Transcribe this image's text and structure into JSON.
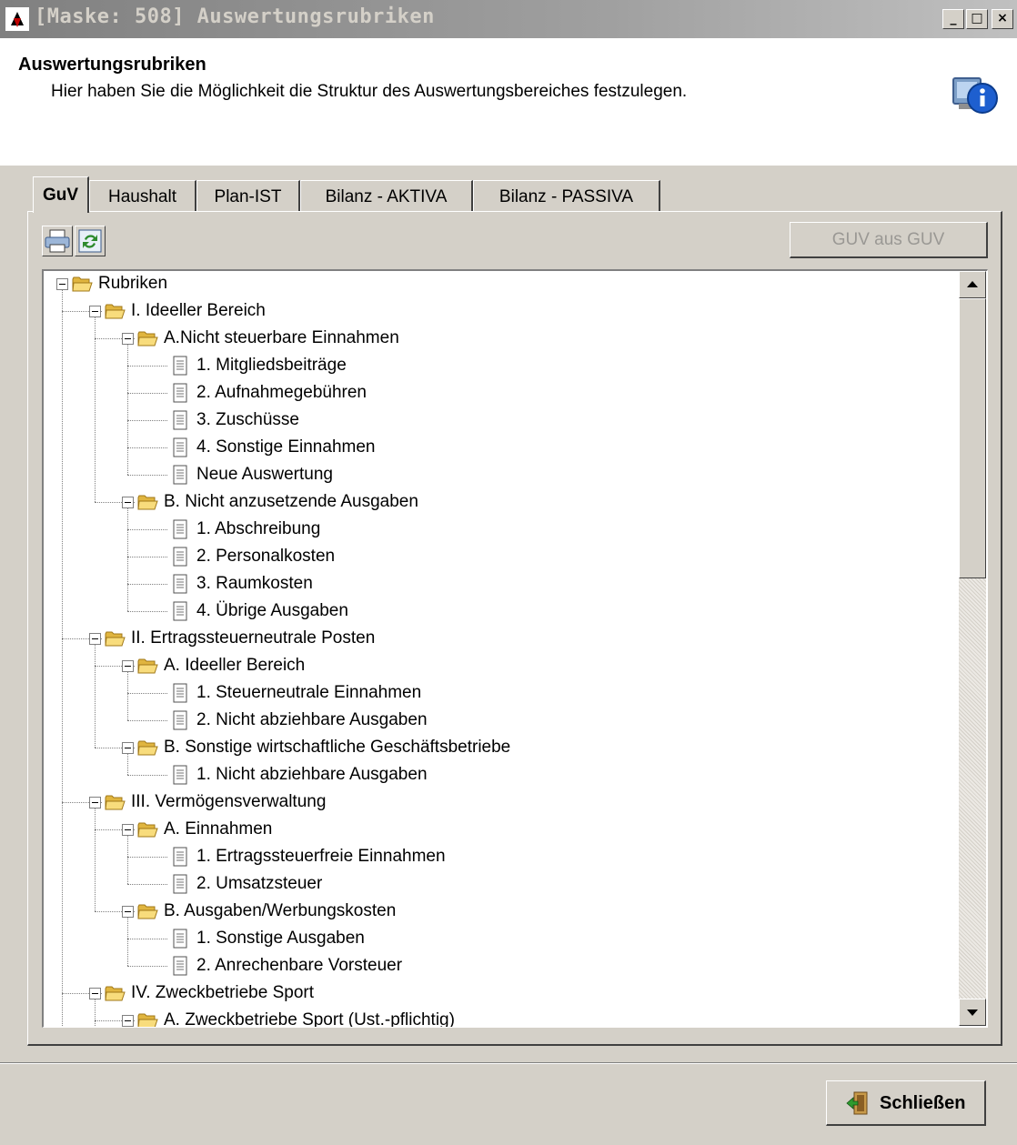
{
  "window": {
    "title": "[Maske: 508] Auswertungsrubriken",
    "controls": [
      "_",
      "□",
      "×"
    ]
  },
  "header": {
    "title": "Auswertungsrubriken",
    "subtitle": "Hier haben Sie die Möglichkeit die Struktur des Auswertungsbereiches festzulegen."
  },
  "tabs": [
    {
      "label": "GuV",
      "active": true
    },
    {
      "label": "Haushalt",
      "active": false
    },
    {
      "label": "Plan-IST",
      "active": false
    },
    {
      "label": "Bilanz - AKTIVA",
      "active": false
    },
    {
      "label": "Bilanz - PASSIVA",
      "active": false
    }
  ],
  "toolbar": {
    "icons": [
      "printer-icon",
      "refresh-icon"
    ],
    "guv_button_label": "GUV aus GUV",
    "guv_button_enabled": false
  },
  "tree": {
    "rows": [
      {
        "label": "Rubriken",
        "level": 0,
        "type": "folder"
      },
      {
        "label": "I. Ideeller Bereich",
        "level": 1,
        "type": "folder"
      },
      {
        "label": "A.Nicht steuerbare Einnahmen",
        "level": 2,
        "type": "folder"
      },
      {
        "label": "1. Mitgliedsbeiträge",
        "level": 3,
        "type": "item"
      },
      {
        "label": "2. Aufnahmegebühren",
        "level": 3,
        "type": "item"
      },
      {
        "label": "3. Zuschüsse",
        "level": 3,
        "type": "item"
      },
      {
        "label": "4. Sonstige Einnahmen",
        "level": 3,
        "type": "item"
      },
      {
        "label": "Neue Auswertung",
        "level": 3,
        "type": "item"
      },
      {
        "label": "B. Nicht anzusetzende Ausgaben",
        "level": 2,
        "type": "folder"
      },
      {
        "label": "1. Abschreibung",
        "level": 3,
        "type": "item"
      },
      {
        "label": "2. Personalkosten",
        "level": 3,
        "type": "item"
      },
      {
        "label": "3. Raumkosten",
        "level": 3,
        "type": "item"
      },
      {
        "label": "4. Übrige Ausgaben",
        "level": 3,
        "type": "item"
      },
      {
        "label": "II. Ertragssteuerneutrale Posten",
        "level": 1,
        "type": "folder"
      },
      {
        "label": "A. Ideeller Bereich",
        "level": 2,
        "type": "folder"
      },
      {
        "label": "1. Steuerneutrale Einnahmen",
        "level": 3,
        "type": "item"
      },
      {
        "label": "2. Nicht abziehbare Ausgaben",
        "level": 3,
        "type": "item"
      },
      {
        "label": "B. Sonstige wirtschaftliche Geschäftsbetriebe",
        "level": 2,
        "type": "folder"
      },
      {
        "label": "1. Nicht abziehbare Ausgaben",
        "level": 3,
        "type": "item"
      },
      {
        "label": "III. Vermögensverwaltung",
        "level": 1,
        "type": "folder"
      },
      {
        "label": "A. Einnahmen",
        "level": 2,
        "type": "folder"
      },
      {
        "label": "1. Ertragssteuerfreie Einnahmen",
        "level": 3,
        "type": "item"
      },
      {
        "label": "2. Umsatzsteuer",
        "level": 3,
        "type": "item"
      },
      {
        "label": "B. Ausgaben/Werbungskosten",
        "level": 2,
        "type": "folder"
      },
      {
        "label": "1. Sonstige Ausgaben",
        "level": 3,
        "type": "item"
      },
      {
        "label": "2. Anrechenbare Vorsteuer",
        "level": 3,
        "type": "item"
      },
      {
        "label": "IV. Zweckbetriebe Sport",
        "level": 1,
        "type": "folder"
      },
      {
        "label": "A. Zweckbetriebe Sport (Ust.-pflichtig)",
        "level": 2,
        "type": "folder"
      }
    ]
  },
  "footer": {
    "close_label": "Schließen"
  },
  "colors": {
    "window_bg": "#d4d0c8",
    "title_bar": "#808080",
    "folder": "#f5d36a",
    "disabled_text": "#9a9894"
  }
}
